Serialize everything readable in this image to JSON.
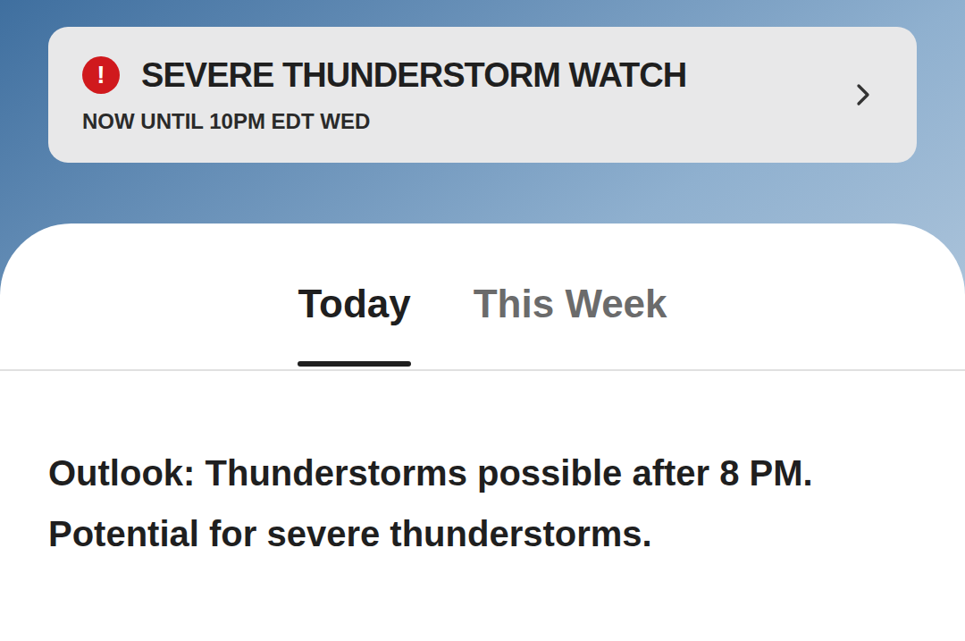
{
  "alert": {
    "icon": "!",
    "title": "SEVERE THUNDERSTORM WATCH",
    "subtitle": "NOW UNTIL 10PM EDT WED"
  },
  "tabs": [
    {
      "label": "Today",
      "selected": true
    },
    {
      "label": "This Week",
      "selected": false
    }
  ],
  "outlook": "Outlook: Thunderstorms possible after 8 PM. Potential for severe thunderstorms."
}
